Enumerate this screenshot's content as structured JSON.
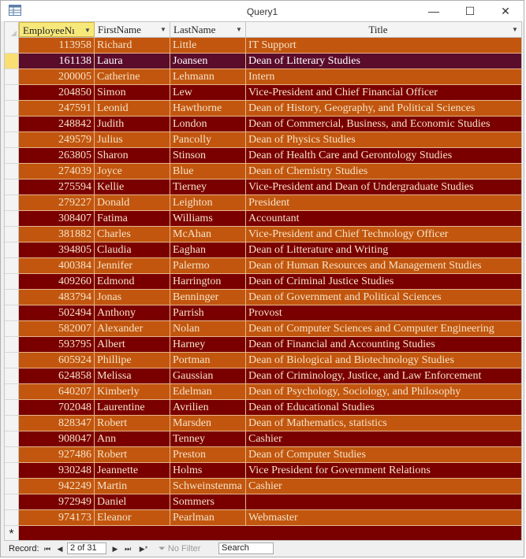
{
  "window": {
    "title": "Query1",
    "minimize_glyph": "—",
    "maximize_glyph": "☐",
    "close_glyph": "✕"
  },
  "table": {
    "columns": [
      {
        "label": "EmployeeNı"
      },
      {
        "label": "FirstName"
      },
      {
        "label": "LastName"
      },
      {
        "label": "Title"
      }
    ],
    "current_row_index": 1,
    "colors": {
      "row_a": "#c2560e",
      "row_b": "#7a0000",
      "current_row": "#5a0c2a"
    },
    "rows": [
      {
        "id": "113958",
        "first": "Richard",
        "last": "Little",
        "title": "IT Support"
      },
      {
        "id": "161138",
        "first": "Laura",
        "last": "Joansen",
        "title": "Dean of Litterary Studies"
      },
      {
        "id": "200005",
        "first": "Catherine",
        "last": "Lehmann",
        "title": "Intern"
      },
      {
        "id": "204850",
        "first": "Simon",
        "last": "Lew",
        "title": "Vice-President and Chief Financial Officer"
      },
      {
        "id": "247591",
        "first": "Leonid",
        "last": "Hawthorne",
        "title": "Dean of History, Geography, and Political Sciences"
      },
      {
        "id": "248842",
        "first": "Judith",
        "last": "London",
        "title": "Dean of Commercial, Business, and Economic Studies"
      },
      {
        "id": "249579",
        "first": "Julius",
        "last": "Pancolly",
        "title": "Dean of Physics Studies"
      },
      {
        "id": "263805",
        "first": "Sharon",
        "last": "Stinson",
        "title": "Dean of Health Care and Gerontology Studies"
      },
      {
        "id": "274039",
        "first": "Joyce",
        "last": "Blue",
        "title": "Dean of Chemistry Studies"
      },
      {
        "id": "275594",
        "first": "Kellie",
        "last": "Tierney",
        "title": "Vice-President and Dean of Undergraduate Studies"
      },
      {
        "id": "279227",
        "first": "Donald",
        "last": "Leighton",
        "title": "President"
      },
      {
        "id": "308407",
        "first": "Fatima",
        "last": "Williams",
        "title": "Accountant"
      },
      {
        "id": "381882",
        "first": "Charles",
        "last": "McAhan",
        "title": "Vice-President and Chief Technology Officer"
      },
      {
        "id": "394805",
        "first": "Claudia",
        "last": "Eaghan",
        "title": "Dean of Litterature and Writing"
      },
      {
        "id": "400384",
        "first": "Jennifer",
        "last": "Palermo",
        "title": "Dean of Human Resources and Management Studies"
      },
      {
        "id": "409260",
        "first": "Edmond",
        "last": "Harrington",
        "title": "Dean of Criminal Justice Studies"
      },
      {
        "id": "483794",
        "first": "Jonas",
        "last": "Benninger",
        "title": "Dean of Government and Political Sciences"
      },
      {
        "id": "502494",
        "first": "Anthony",
        "last": "Parrish",
        "title": "Provost"
      },
      {
        "id": "582007",
        "first": "Alexander",
        "last": "Nolan",
        "title": "Dean of Computer Sciences and Computer Engineering"
      },
      {
        "id": "593795",
        "first": "Albert",
        "last": "Harney",
        "title": "Dean of Financial and Accounting Studies"
      },
      {
        "id": "605924",
        "first": "Phillipe",
        "last": "Portman",
        "title": "Dean of Biological and Biotechnology Studies"
      },
      {
        "id": "624858",
        "first": "Melissa",
        "last": "Gaussian",
        "title": "Dean of Criminology, Justice, and Law Enforcement"
      },
      {
        "id": "640207",
        "first": "Kimberly",
        "last": "Edelman",
        "title": "Dean of Psychology, Sociology, and Philosophy"
      },
      {
        "id": "702048",
        "first": "Laurentine",
        "last": "Avrilien",
        "title": "Dean of Educational Studies"
      },
      {
        "id": "828347",
        "first": "Robert",
        "last": "Marsden",
        "title": "Dean of Mathematics, statistics"
      },
      {
        "id": "908047",
        "first": "Ann",
        "last": "Tenney",
        "title": "Cashier"
      },
      {
        "id": "927486",
        "first": "Robert",
        "last": "Preston",
        "title": "Dean of Computer Studies"
      },
      {
        "id": "930248",
        "first": "Jeannette",
        "last": "Holms",
        "title": "Vice President for Government Relations"
      },
      {
        "id": "942249",
        "first": "Martin",
        "last": "Schweinstenma",
        "title": "Cashier"
      },
      {
        "id": "972949",
        "first": "Daniel",
        "last": "Sommers",
        "title": ""
      },
      {
        "id": "974173",
        "first": "Eleanor",
        "last": "Pearlman",
        "title": "Webmaster"
      }
    ],
    "new_row_marker": "*"
  },
  "statusbar": {
    "record_label": "Record:",
    "first_glyph": "⏮",
    "prev_glyph": "◀",
    "record_value": "2 of 31",
    "next_glyph": "▶",
    "last_glyph": "⏭",
    "new_glyph": "▶*",
    "filter_label": "No Filter",
    "search_placeholder": "Search"
  }
}
